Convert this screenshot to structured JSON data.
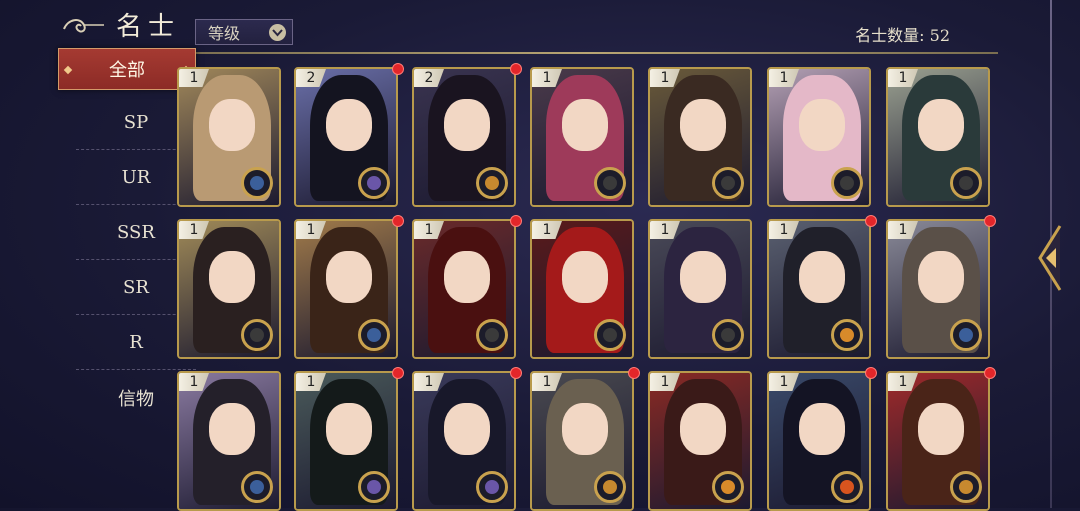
{
  "header": {
    "title": "名士",
    "sort_label": "等级",
    "count_label": "名士数量: 52"
  },
  "sidebar": {
    "items": [
      {
        "label": "全部",
        "active": true
      },
      {
        "label": "SP"
      },
      {
        "label": "UR"
      },
      {
        "label": "SSR"
      },
      {
        "label": "SR"
      },
      {
        "label": "R"
      },
      {
        "label": "信物"
      }
    ]
  },
  "cards": [
    {
      "rank": "1",
      "hair": "#b99a73",
      "bg": "#a0875a",
      "badge": "#3b5f9a",
      "dot": false
    },
    {
      "rank": "2",
      "hair": "#141420",
      "bg": "#6a6fa8",
      "badge": "#6a56a8",
      "dot": true
    },
    {
      "rank": "2",
      "hair": "#1a1420",
      "bg": "#3a3450",
      "badge": "#c7892f",
      "dot": true
    },
    {
      "rank": "1",
      "hair": "#9e3a5a",
      "bg": "#4a3a4a",
      "badge": "#3a3a3a",
      "dot": false
    },
    {
      "rank": "1",
      "hair": "#3a2a22",
      "bg": "#6a5a3a",
      "badge": "#3a3a3a",
      "dot": false
    },
    {
      "rank": "1",
      "hair": "#e4b8c8",
      "bg": "#b4a0b4",
      "badge": "#3a3a3a",
      "dot": false
    },
    {
      "rank": "1",
      "hair": "#2a3a3a",
      "bg": "#9aa090",
      "badge": "#3a3a3a",
      "dot": false
    },
    {
      "rank": "1",
      "hair": "#2a2020",
      "bg": "#a08a58",
      "badge": "#3a3a3a",
      "dot": false
    },
    {
      "rank": "1",
      "hair": "#3a2418",
      "bg": "#a07a4a",
      "badge": "#3b5f9a",
      "dot": true
    },
    {
      "rank": "1",
      "hair": "#4a1010",
      "bg": "#6a2a2a",
      "badge": "#3a3a3a",
      "dot": true
    },
    {
      "rank": "1",
      "hair": "#a41a1a",
      "bg": "#5a1a1a",
      "badge": "#3a3a3a",
      "dot": false
    },
    {
      "rank": "1",
      "hair": "#2c2440",
      "bg": "#4a4a58",
      "badge": "#3a3a3a",
      "dot": false
    },
    {
      "rank": "1",
      "hair": "#20202a",
      "bg": "#5a6070",
      "badge": "#d88a2a",
      "dot": true
    },
    {
      "rank": "1",
      "hair": "#5a5048",
      "bg": "#8a8a98",
      "badge": "#3b5f9a",
      "dot": true
    },
    {
      "rank": "1",
      "hair": "#24202a",
      "bg": "#8a7aa0",
      "badge": "#3b5f9a",
      "dot": false
    },
    {
      "rank": "1",
      "hair": "#141a1a",
      "bg": "#4a5a5a",
      "badge": "#6a56a8",
      "dot": true
    },
    {
      "rank": "1",
      "hair": "#18182a",
      "bg": "#3a3a5a",
      "badge": "#6a56a8",
      "dot": true
    },
    {
      "rank": "1",
      "hair": "#6a6050",
      "bg": "#4a4a50",
      "badge": "#c7892f",
      "dot": true
    },
    {
      "rank": "1",
      "hair": "#3a1a18",
      "bg": "#8a2a24",
      "badge": "#d88a2a",
      "dot": false
    },
    {
      "rank": "1",
      "hair": "#141424",
      "bg": "#3a4a6a",
      "badge": "#d8541e",
      "dot": true
    },
    {
      "rank": "1",
      "hair": "#4a2418",
      "bg": "#a02a2a",
      "badge": "#c7892f",
      "dot": true
    }
  ],
  "colors": {
    "accent_red": "#a53a32",
    "frame_gold": "#b89a4c",
    "notify_red": "#e3262a"
  },
  "icons": [
    "swirl-icon",
    "chevron-down-icon",
    "badge-icon",
    "arrow-left-icon"
  ]
}
